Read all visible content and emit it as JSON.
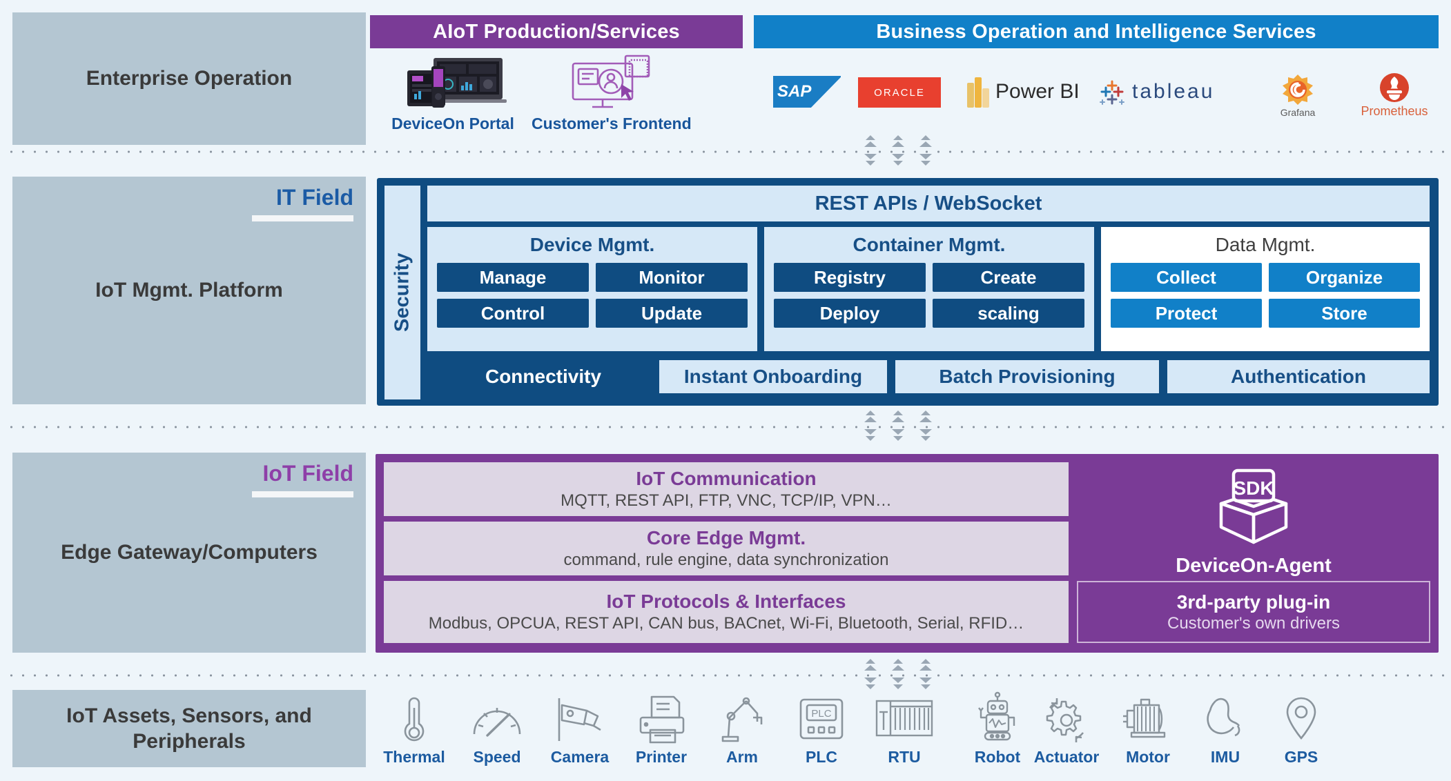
{
  "rows": {
    "enterprise": {
      "label": "Enterprise Operation",
      "banner_aiot": "AIoT Production/Services",
      "banner_bi": "Business Operation and Intelligence Services",
      "apps": [
        {
          "caption": "DeviceOn Portal",
          "icon": "devices-mockup-icon"
        },
        {
          "caption": "Customer's Frontend",
          "icon": "frontend-ui-icon"
        }
      ],
      "logos": [
        {
          "name": "SAP",
          "icon": "sap-logo"
        },
        {
          "name": "ORACLE",
          "icon": "oracle-logo"
        },
        {
          "name": "Power BI",
          "icon": "power-bi-logo"
        },
        {
          "name": "tableau",
          "icon": "tableau-logo"
        },
        {
          "name": "Grafana",
          "icon": "grafana-logo"
        },
        {
          "name": "Prometheus",
          "icon": "prometheus-logo"
        }
      ]
    },
    "it": {
      "label": "IoT Mgmt. Platform",
      "field_tag": "IT Field",
      "security": "Security",
      "rest_bar": "REST APIs / WebSocket",
      "groups": [
        {
          "title": "Device Mgmt.",
          "style": "light",
          "chips": [
            "Manage",
            "Monitor",
            "Control",
            "Update"
          ],
          "chip_style": "navy"
        },
        {
          "title": "Container Mgmt.",
          "style": "light",
          "chips": [
            "Registry",
            "Create",
            "Deploy",
            "scaling"
          ],
          "chip_style": "navy"
        },
        {
          "title": "Data Mgmt.",
          "style": "white",
          "chips": [
            "Collect",
            "Organize",
            "Protect",
            "Store"
          ],
          "chip_style": "bright"
        }
      ],
      "footer": [
        {
          "text": "Connectivity",
          "style": "onnavy"
        },
        {
          "text": "Instant Onboarding",
          "style": "tab"
        },
        {
          "text": "Batch Provisioning",
          "style": "tab"
        },
        {
          "text": "Authentication",
          "style": "tab"
        }
      ]
    },
    "edge": {
      "label": "Edge Gateway/Computers",
      "field_tag": "IoT Field",
      "cards": [
        {
          "title": "IoT Communication",
          "subtitle": "MQTT, REST API, FTP, VNC, TCP/IP, VPN…"
        },
        {
          "title": "Core Edge Mgmt.",
          "subtitle": "command, rule engine, data synchronization"
        },
        {
          "title": "IoT Protocols & Interfaces",
          "subtitle": "Modbus, OPCUA, REST API, CAN bus, BACnet, Wi-Fi, Bluetooth, Serial, RFID…"
        }
      ],
      "agent": {
        "badge": "SDK",
        "name": "DeviceOn-Agent",
        "icon": "sdk-box-icon"
      },
      "plugin": {
        "title": "3rd-party plug-in",
        "subtitle": "Customer's own drivers"
      }
    },
    "assets": {
      "label": "IoT Assets, Sensors, and Peripherals",
      "items": [
        {
          "label": "Thermal",
          "icon": "thermometer-icon"
        },
        {
          "label": "Speed",
          "icon": "gauge-icon"
        },
        {
          "label": "Camera",
          "icon": "cctv-camera-icon"
        },
        {
          "label": "Printer",
          "icon": "printer-icon"
        },
        {
          "label": "Arm",
          "icon": "robot-arm-icon"
        },
        {
          "label": "PLC",
          "icon": "plc-icon"
        },
        {
          "label": "RTU",
          "icon": "rtu-rack-icon"
        },
        {
          "label": "Robot",
          "icon": "robot-icon"
        },
        {
          "label": "Actuator",
          "icon": "actuator-gear-icon"
        },
        {
          "label": "Motor",
          "icon": "motor-icon"
        },
        {
          "label": "IMU",
          "icon": "imu-icon"
        },
        {
          "label": "GPS",
          "icon": "gps-pin-icon"
        }
      ]
    }
  },
  "colors": {
    "purple": "#7a3b96",
    "blue": "#1180c8",
    "navy": "#0f4c81",
    "light_blue": "#d6e8f7",
    "panel_grey": "#b4c6d2",
    "background": "#eef5fa"
  }
}
